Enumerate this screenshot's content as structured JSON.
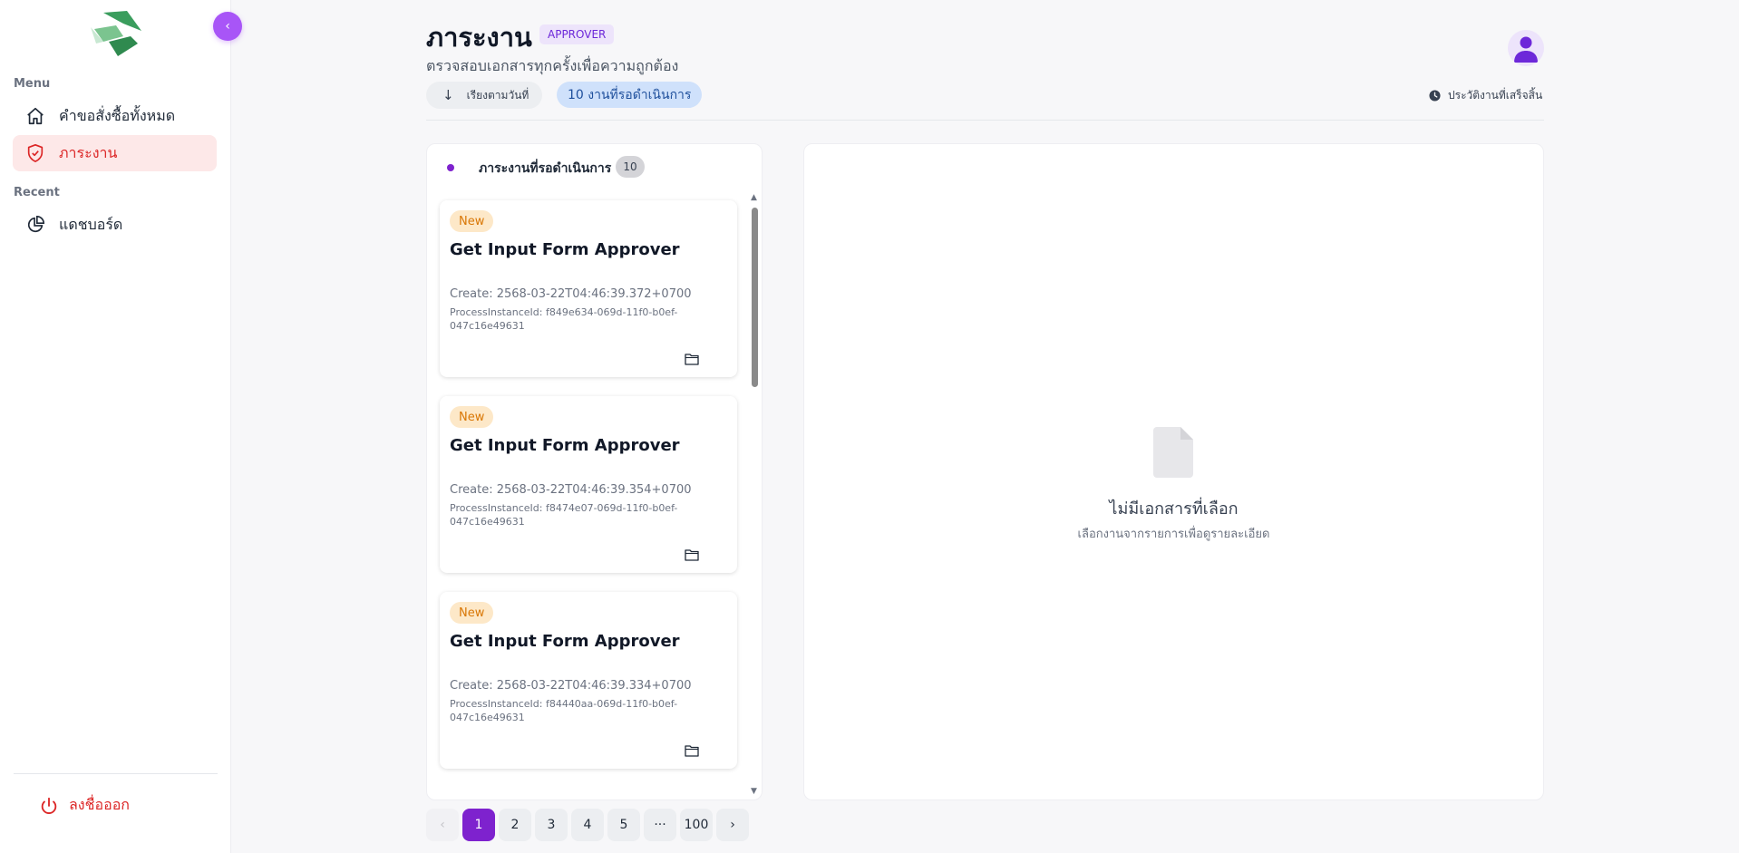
{
  "sidebar": {
    "collapse_icon": "chevron-left-icon",
    "menu_heading": "Menu",
    "items": [
      {
        "label": "คำขอสั่งซื้อทั้งหมด",
        "icon": "home-icon"
      },
      {
        "label": "ภาระงาน",
        "icon": "shield-check-icon",
        "active": true
      }
    ],
    "recent_heading": "Recent",
    "recent_items": [
      {
        "label": "แดชบอร์ด",
        "icon": "pie-chart-icon"
      }
    ],
    "logout_label": "ลงชื่อออก",
    "logout_icon": "power-icon"
  },
  "header": {
    "title": "ภาระงาน",
    "role_badge": "APPROVER",
    "subtitle": "ตรวจสอบเอกสารทุกครั้งเพื่อความถูกต้อง",
    "sort_label": "เรียงตามวันที่",
    "sort_icon": "arrow-down-icon",
    "pending_chip": "10 งานที่รอดำเนินการ",
    "history_label": "ประวัติงานที่เสร็จสิ้น",
    "history_icon": "clock-icon"
  },
  "task_panel": {
    "title": "ภาระงานที่รอดำเนินการ",
    "count": "10",
    "cards": [
      {
        "badge": "New",
        "title": "Get Input Form Approver",
        "create": "Create: 2568-03-22T04:46:39.372+0700",
        "process_id": "ProcessInstanceId: f849e634-069d-11f0-b0ef-047c16e49631"
      },
      {
        "badge": "New",
        "title": "Get Input Form Approver",
        "create": "Create: 2568-03-22T04:46:39.354+0700",
        "process_id": "ProcessInstanceId: f8474e07-069d-11f0-b0ef-047c16e49631"
      },
      {
        "badge": "New",
        "title": "Get Input Form Approver",
        "create": "Create: 2568-03-22T04:46:39.334+0700",
        "process_id": "ProcessInstanceId: f84440aa-069d-11f0-b0ef-047c16e49631"
      }
    ]
  },
  "detail_panel": {
    "empty_title": "ไม่มีเอกสารที่เลือก",
    "empty_desc": "เลือกงานจากรายการเพื่อดูรายละเอียด",
    "empty_icon": "document-icon"
  },
  "pagination": {
    "prev": "‹",
    "pages": [
      "1",
      "2",
      "3",
      "4",
      "5",
      "···",
      "100"
    ],
    "current": "1",
    "next": "›"
  },
  "colors": {
    "accent": "#7e22ce",
    "active_item": "#dc2626",
    "collapse_button": "#a855f7"
  }
}
